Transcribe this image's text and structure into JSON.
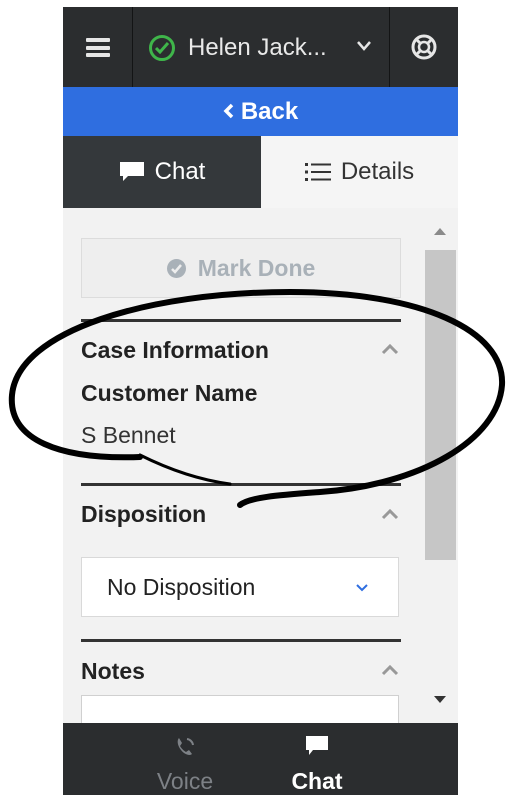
{
  "header": {
    "user_name": "Helen Jack..."
  },
  "nav": {
    "back_label": "Back"
  },
  "tabs": [
    {
      "label": "Chat",
      "active": true
    },
    {
      "label": "Details",
      "active": false
    }
  ],
  "actions": {
    "mark_done_label": "Mark Done"
  },
  "case_info": {
    "title": "Case Information",
    "field_label": "Customer Name",
    "field_value": "S Bennet"
  },
  "disposition": {
    "title": "Disposition",
    "selected": "No Disposition"
  },
  "notes": {
    "title": "Notes"
  },
  "bottom_tabs": [
    {
      "label": "Voice",
      "active": false
    },
    {
      "label": "Chat",
      "active": true
    }
  ],
  "colors": {
    "header_bg": "#2b2d2f",
    "back_bar": "#2f6ee0",
    "status_ready": "#3fb54a",
    "active_tab": "#34383b"
  }
}
